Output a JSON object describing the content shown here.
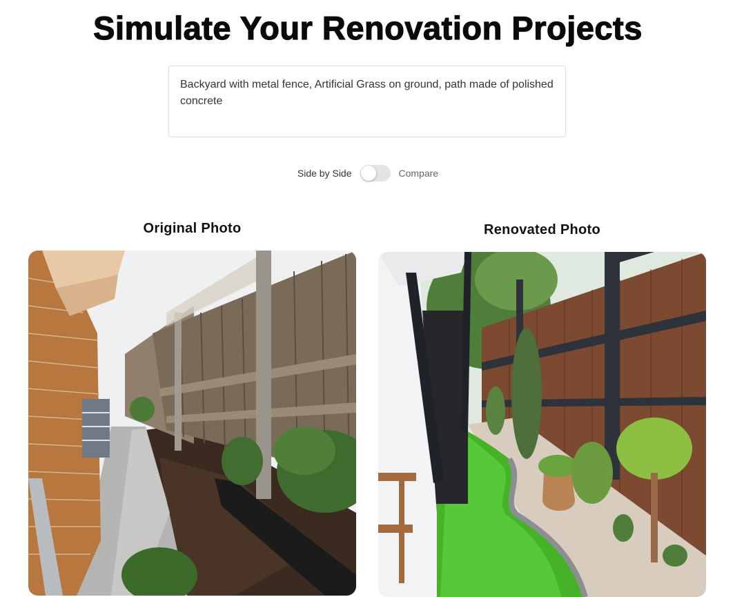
{
  "page": {
    "title": "Simulate Your Renovation Projects"
  },
  "prompt": {
    "value": "Backyard with metal fence, Artificial Grass on ground, path made of polished concrete"
  },
  "view_toggle": {
    "left_label": "Side by Side",
    "right_label": "Compare",
    "state": "side-by-side"
  },
  "original": {
    "label": "Original Photo"
  },
  "renovated": {
    "label": "Renovated Photo"
  }
}
